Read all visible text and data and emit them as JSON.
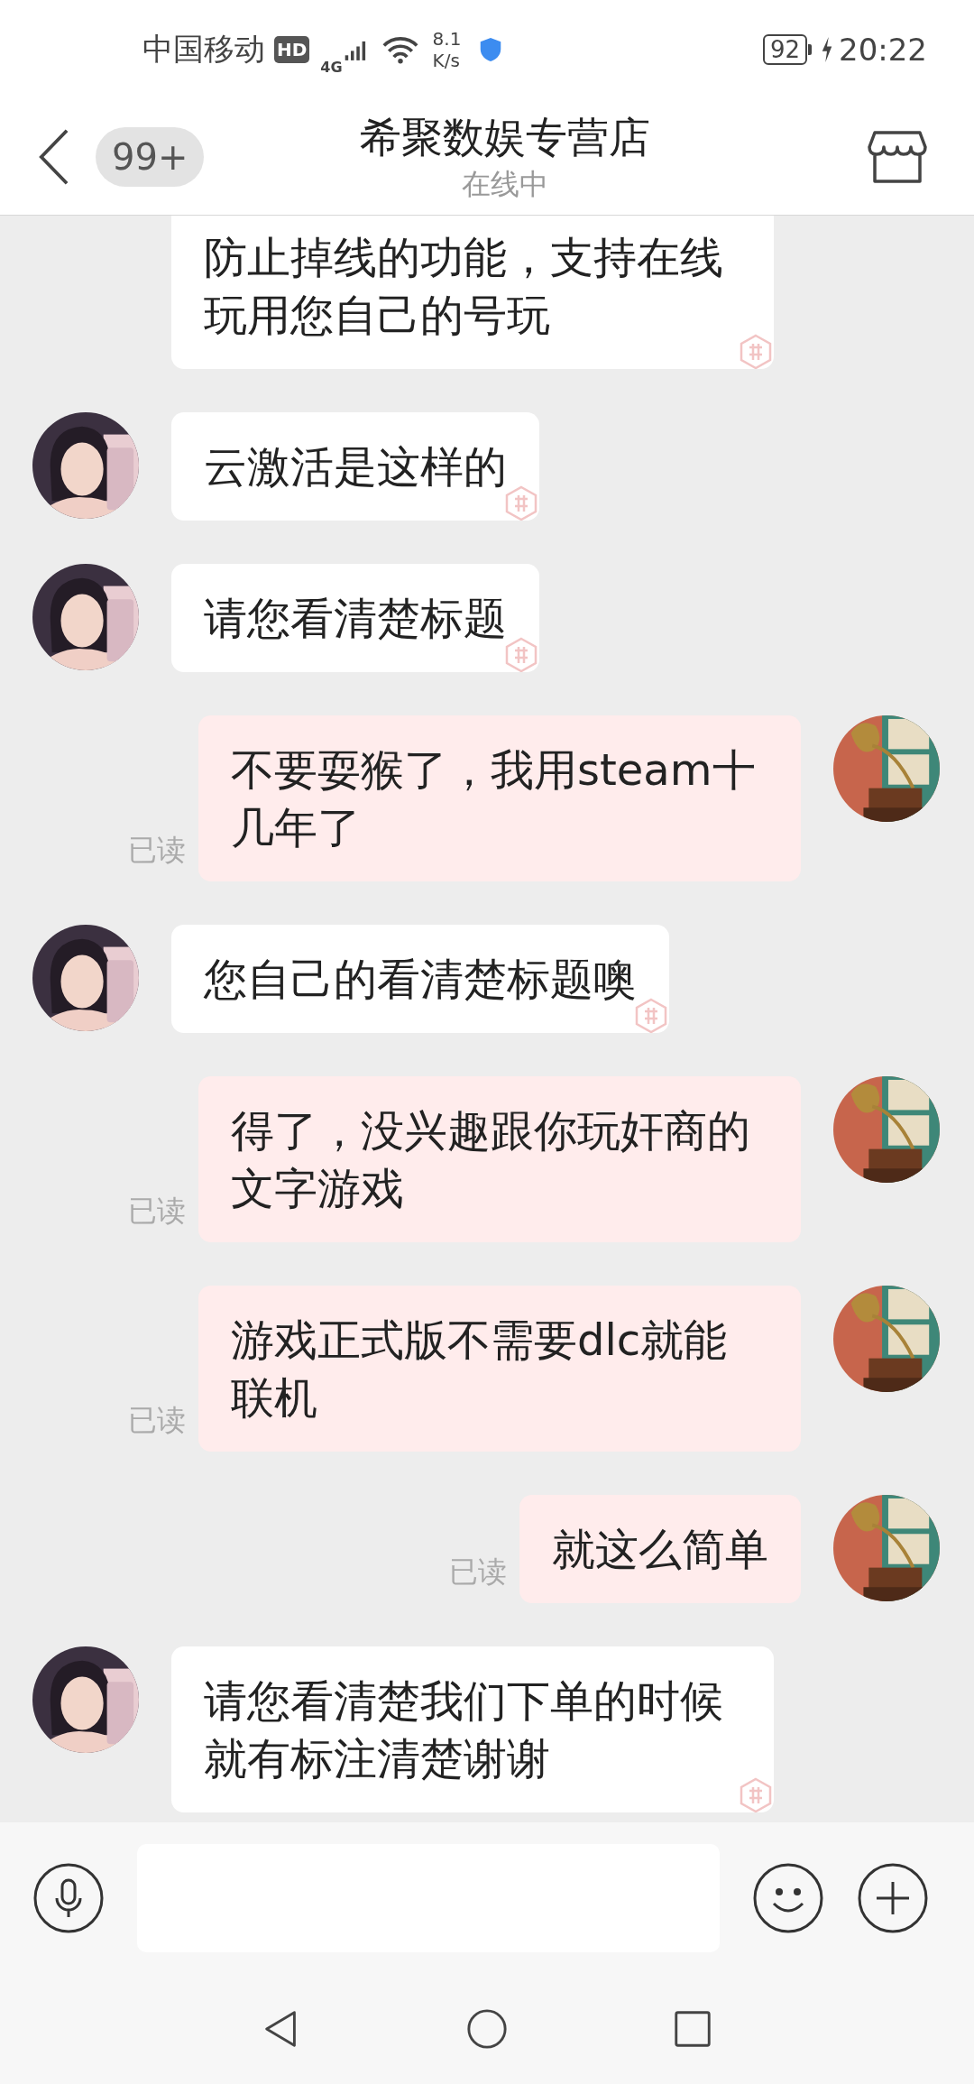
{
  "status_bar": {
    "carrier": "中国移动",
    "hd": "HD",
    "network": "4G",
    "speed_value": "8.1",
    "speed_unit": "K/s",
    "battery": "92",
    "time": "20:22"
  },
  "header": {
    "badge": "99+",
    "title": "希聚数娱专营店",
    "subtitle": "在线中"
  },
  "messages": [
    {
      "kind": "left",
      "clipped": true,
      "text": "防止掉线的功能，支持在线玩用您自己的号玩"
    },
    {
      "kind": "left",
      "clipped": false,
      "text": "云激活是这样的"
    },
    {
      "kind": "left",
      "clipped": false,
      "text": "请您看清楚标题"
    },
    {
      "kind": "right",
      "clipped": false,
      "text": "不要耍猴了，我用steam十几年了",
      "receipt": "已读"
    },
    {
      "kind": "left",
      "clipped": false,
      "text": "您自己的看清楚标题噢"
    },
    {
      "kind": "right",
      "clipped": false,
      "text": "得了，没兴趣跟你玩奸商的文字游戏",
      "receipt": "已读"
    },
    {
      "kind": "right",
      "clipped": false,
      "text": "游戏正式版不需要dlc就能联机",
      "receipt": "已读"
    },
    {
      "kind": "right",
      "clipped": false,
      "text": "就这么简单",
      "receipt": "已读"
    },
    {
      "kind": "left",
      "clipped": false,
      "text": "请您看清楚我们下单的时候就有标注清楚谢谢"
    }
  ]
}
